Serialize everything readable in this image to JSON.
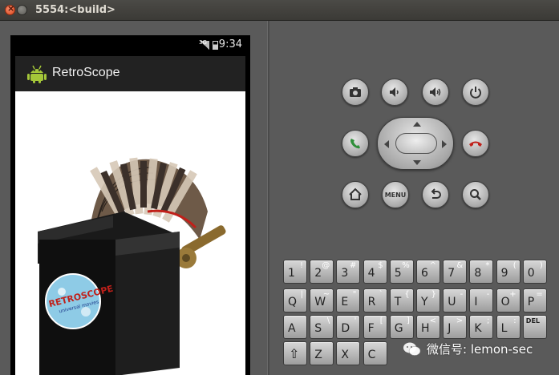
{
  "window": {
    "title": "5554:<build>"
  },
  "status_bar": {
    "network": "3G",
    "time": "9:34"
  },
  "app": {
    "title": "RetroScope"
  },
  "sticker_text": {
    "line1": "RETROSCOPE",
    "line2": "universal movies"
  },
  "controls": {
    "row1": [
      "camera-icon",
      "volume-down-icon",
      "volume-up-icon",
      "power-icon"
    ],
    "call_icon": "call-icon",
    "end_call_icon": "end-call-icon",
    "home_icon": "home-icon",
    "menu_label": "MENU",
    "back_icon": "back-icon",
    "search_icon": "search-icon"
  },
  "keyboard": {
    "row1": [
      {
        "main": "1",
        "alt": "!"
      },
      {
        "main": "2",
        "alt": "@"
      },
      {
        "main": "3",
        "alt": "#"
      },
      {
        "main": "4",
        "alt": "$"
      },
      {
        "main": "5",
        "alt": "%"
      },
      {
        "main": "6",
        "alt": "^"
      },
      {
        "main": "7",
        "alt": "&"
      },
      {
        "main": "8",
        "alt": "*"
      },
      {
        "main": "9",
        "alt": "("
      },
      {
        "main": "0",
        "alt": ")"
      }
    ],
    "row2": [
      {
        "main": "Q",
        "alt": "|"
      },
      {
        "main": "W",
        "alt": "~"
      },
      {
        "main": "E",
        "alt": "\""
      },
      {
        "main": "R",
        "alt": "`"
      },
      {
        "main": "T",
        "alt": "{"
      },
      {
        "main": "Y",
        "alt": "}"
      },
      {
        "main": "U",
        "alt": "-"
      },
      {
        "main": "I",
        "alt": "-"
      },
      {
        "main": "O",
        "alt": "+"
      },
      {
        "main": "P",
        "alt": "="
      }
    ],
    "row3": [
      {
        "main": "A",
        "alt": ""
      },
      {
        "main": "S",
        "alt": "\\"
      },
      {
        "main": "D",
        "alt": "'"
      },
      {
        "main": "F",
        "alt": "["
      },
      {
        "main": "G",
        "alt": "]"
      },
      {
        "main": "H",
        "alt": "<"
      },
      {
        "main": "J",
        "alt": ">"
      },
      {
        "main": "K",
        "alt": ";"
      },
      {
        "main": "L",
        "alt": ":"
      },
      {
        "main": "DEL",
        "alt": ""
      }
    ],
    "row4": [
      {
        "main": "⇧",
        "alt": ""
      },
      {
        "main": "Z",
        "alt": ""
      },
      {
        "main": "X",
        "alt": ""
      },
      {
        "main": "C",
        "alt": ""
      }
    ]
  },
  "watermark": {
    "text": "微信号: lemon-sec"
  },
  "colors": {
    "call_green": "#2f8f3a",
    "end_call_red": "#c0201a",
    "android_green": "#a4c639"
  }
}
